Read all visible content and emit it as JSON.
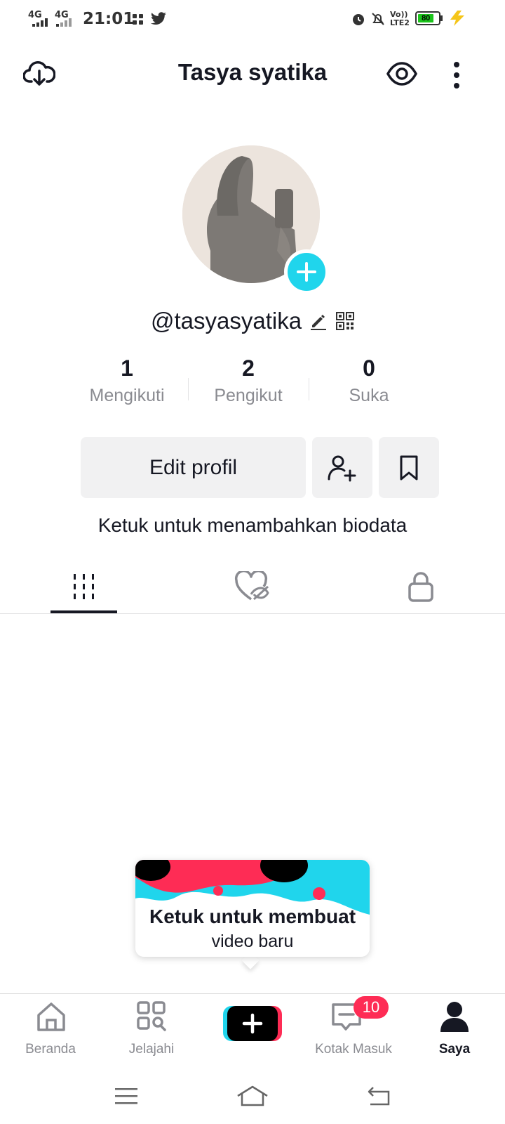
{
  "status_bar": {
    "net1": "4G",
    "net2": "4G",
    "time": "21:01",
    "volte": "Vo)) LTE2",
    "battery": "80",
    "accent": "#1bc41b"
  },
  "header": {
    "title": "Tasya syatika"
  },
  "profile": {
    "handle": "@tasyasyatika"
  },
  "stats": [
    {
      "count": "1",
      "label": "Mengikuti"
    },
    {
      "count": "2",
      "label": "Pengikut"
    },
    {
      "count": "0",
      "label": "Suka"
    }
  ],
  "actions": {
    "edit_label": "Edit profil"
  },
  "bio_prompt": "Ketuk untuk menambahkan biodata",
  "tabs": [
    "videos-grid-icon",
    "liked-hidden-icon",
    "lock-icon"
  ],
  "tooltip": {
    "title": "Ketuk untuk membuat",
    "subtitle": "video baru"
  },
  "bottom_nav": {
    "items": [
      {
        "label": "Beranda",
        "icon": "home-icon"
      },
      {
        "label": "Jelajahi",
        "icon": "discover-icon"
      },
      {
        "label": "",
        "icon": "create-plus-icon"
      },
      {
        "label": "Kotak Masuk",
        "icon": "inbox-icon"
      },
      {
        "label": "Saya",
        "icon": "profile-icon"
      }
    ],
    "inbox_badge": "10"
  },
  "colors": {
    "accent_cyan": "#20d5ec",
    "accent_pink": "#fe2c55",
    "text": "#161823",
    "muted": "#8a8b91"
  }
}
